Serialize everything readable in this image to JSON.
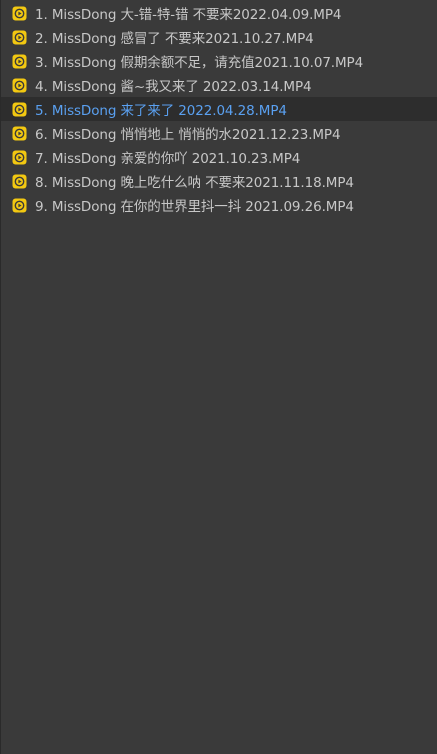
{
  "playlist": {
    "active_index": 4,
    "icon": "video-file-icon",
    "icon_color": "#f2c811",
    "text_color": "#c7c7c7",
    "active_text_color": "#5aa0f0",
    "items": [
      {
        "label": "1. MissDong 大-错-特-错 不要来2022.04.09.MP4"
      },
      {
        "label": "2. MissDong 感冒了 不要来2021.10.27.MP4"
      },
      {
        "label": "3. MissDong 假期余额不足，请充值2021.10.07.MP4"
      },
      {
        "label": "4. MissDong 酱~我又来了 2022.03.14.MP4"
      },
      {
        "label": "5. MissDong 来了来了 2022.04.28.MP4"
      },
      {
        "label": "6. MissDong 悄悄地上 悄悄的水2021.12.23.MP4"
      },
      {
        "label": "7. MissDong 亲爱的你吖 2021.10.23.MP4"
      },
      {
        "label": "8. MissDong 晚上吃什么呐 不要来2021.11.18.MP4"
      },
      {
        "label": "9. MissDong 在你的世界里抖一抖 2021.09.26.MP4"
      }
    ]
  }
}
